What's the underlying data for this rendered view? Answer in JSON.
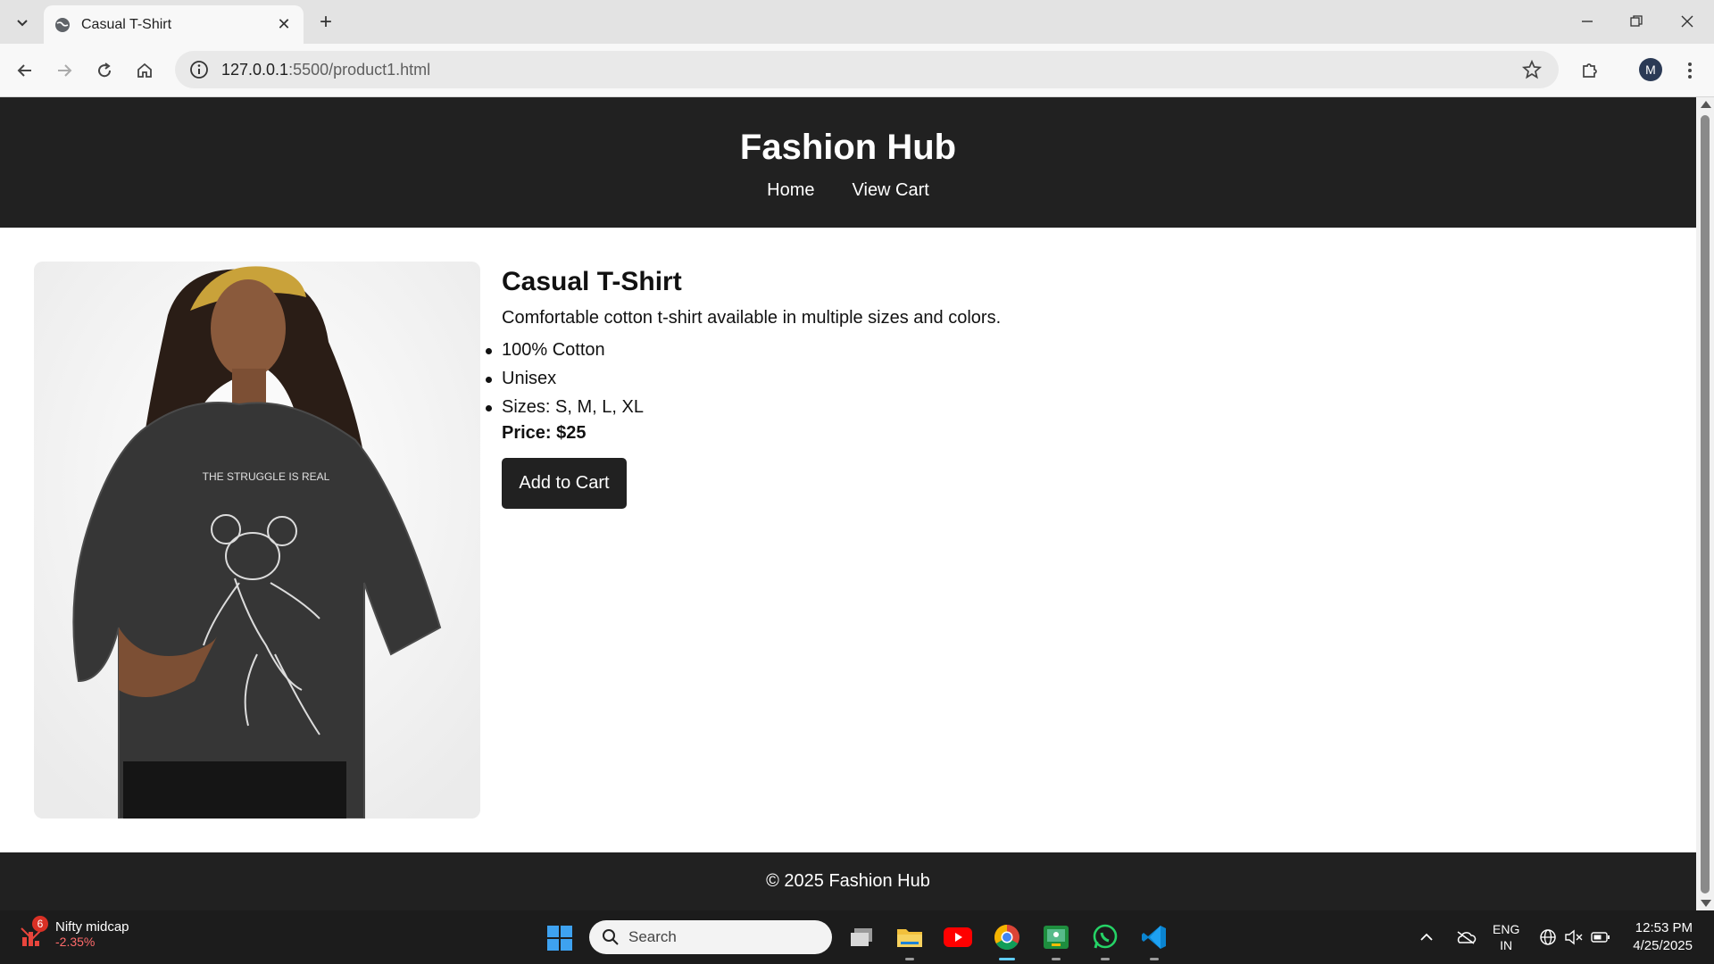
{
  "browser": {
    "tab_title": "Casual T-Shirt",
    "url_host": "127.0.0.1",
    "url_rest": ":5500/product1.html",
    "profile_initial": "M"
  },
  "site": {
    "title": "Fashion Hub",
    "nav": [
      "Home",
      "View Cart"
    ],
    "footer": "© 2025 Fashion Hub"
  },
  "product": {
    "name": "Casual T-Shirt",
    "description": "Comfortable cotton t-shirt available in multiple sizes and colors.",
    "features": [
      "100% Cotton",
      "Unisex",
      "Sizes: S, M, L, XL"
    ],
    "price": "Price: $25",
    "add_button": "Add to Cart",
    "image_alt": "Woman wearing a dark washed oversized t-shirt with a cartoon mouse print",
    "shirt_print": "THE STRUGGLE IS REAL"
  },
  "taskbar": {
    "widget_badge": "6",
    "widget_title": "Nifty midcap",
    "widget_value": "-2.35%",
    "search_placeholder": "Search",
    "lang_top": "ENG",
    "lang_bottom": "IN",
    "time": "12:53 PM",
    "date": "4/25/2025"
  },
  "colors": {
    "header_bg": "#212121",
    "button_bg": "#212121",
    "tabstrip_bg": "#e3e3e3",
    "taskbar_bg": "#1c1c1c"
  }
}
